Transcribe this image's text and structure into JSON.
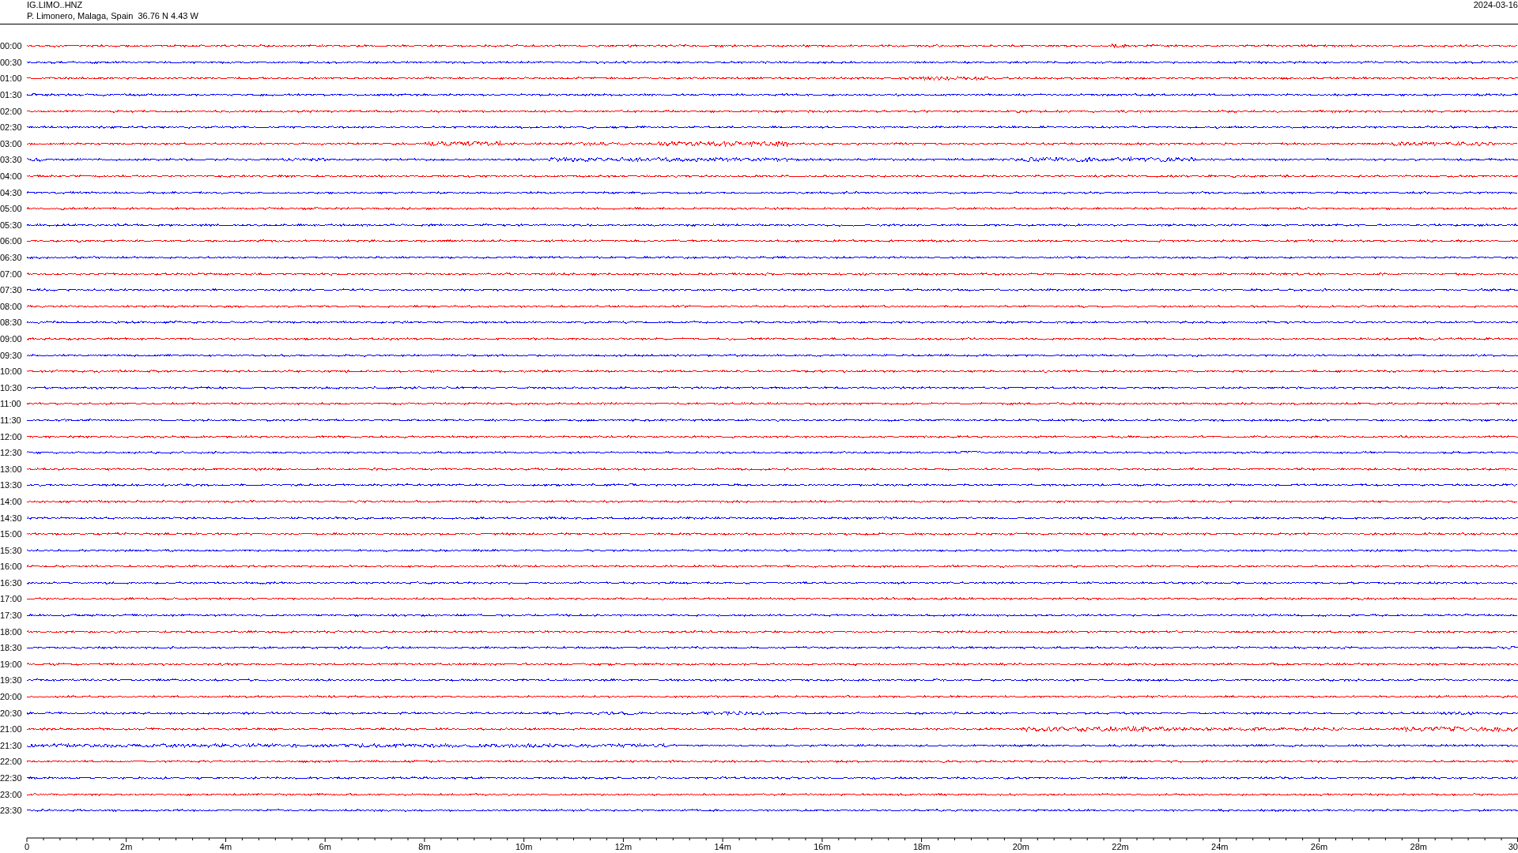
{
  "header": {
    "station": "IG.LIMO..HNZ",
    "location": "P. Limonero, Malaga, Spain  36.76 N 4.43 W",
    "date": "2024-03-16"
  },
  "rows": [
    {
      "label": "00:00",
      "color": "#ff0000"
    },
    {
      "label": "00:30",
      "color": "#0000ff"
    },
    {
      "label": "01:00",
      "color": "#ff0000"
    },
    {
      "label": "01:30",
      "color": "#0000ff"
    },
    {
      "label": "02:00",
      "color": "#ff0000"
    },
    {
      "label": "02:30",
      "color": "#0000ff"
    },
    {
      "label": "03:00",
      "color": "#ff0000"
    },
    {
      "label": "03:30",
      "color": "#0000ff"
    },
    {
      "label": "04:00",
      "color": "#ff0000"
    },
    {
      "label": "04:30",
      "color": "#0000ff"
    },
    {
      "label": "05:00",
      "color": "#ff0000"
    },
    {
      "label": "05:30",
      "color": "#0000ff"
    },
    {
      "label": "06:00",
      "color": "#ff0000"
    },
    {
      "label": "06:30",
      "color": "#0000ff"
    },
    {
      "label": "07:00",
      "color": "#ff0000"
    },
    {
      "label": "07:30",
      "color": "#0000ff"
    },
    {
      "label": "08:00",
      "color": "#ff0000"
    },
    {
      "label": "08:30",
      "color": "#0000ff"
    },
    {
      "label": "09:00",
      "color": "#ff0000"
    },
    {
      "label": "09:30",
      "color": "#0000ff"
    },
    {
      "label": "10:00",
      "color": "#ff0000"
    },
    {
      "label": "10:30",
      "color": "#0000ff"
    },
    {
      "label": "11:00",
      "color": "#ff0000"
    },
    {
      "label": "11:30",
      "color": "#0000ff"
    },
    {
      "label": "12:00",
      "color": "#ff0000"
    },
    {
      "label": "12:30",
      "color": "#0000ff"
    },
    {
      "label": "13:00",
      "color": "#ff0000"
    },
    {
      "label": "13:30",
      "color": "#0000ff"
    },
    {
      "label": "14:00",
      "color": "#ff0000"
    },
    {
      "label": "14:30",
      "color": "#0000ff"
    },
    {
      "label": "15:00",
      "color": "#ff0000"
    },
    {
      "label": "15:30",
      "color": "#0000ff"
    },
    {
      "label": "16:00",
      "color": "#ff0000"
    },
    {
      "label": "16:30",
      "color": "#0000ff"
    },
    {
      "label": "17:00",
      "color": "#ff0000"
    },
    {
      "label": "17:30",
      "color": "#0000ff"
    },
    {
      "label": "18:00",
      "color": "#ff0000"
    },
    {
      "label": "18:30",
      "color": "#0000ff"
    },
    {
      "label": "19:00",
      "color": "#ff0000"
    },
    {
      "label": "19:30",
      "color": "#0000ff"
    },
    {
      "label": "20:00",
      "color": "#ff0000"
    },
    {
      "label": "20:30",
      "color": "#0000ff"
    },
    {
      "label": "21:00",
      "color": "#ff0000"
    },
    {
      "label": "21:30",
      "color": "#0000ff"
    },
    {
      "label": "22:00",
      "color": "#ff0000"
    },
    {
      "label": "22:30",
      "color": "#0000ff"
    },
    {
      "label": "23:00",
      "color": "#ff0000"
    },
    {
      "label": "23:30",
      "color": "#0000ff"
    }
  ],
  "axis": {
    "labels": [
      "0",
      "2m",
      "4m",
      "6m",
      "8m",
      "10m",
      "12m",
      "14m",
      "16m",
      "18m",
      "20m",
      "22m",
      "24m",
      "26m",
      "28m",
      "30"
    ]
  }
}
